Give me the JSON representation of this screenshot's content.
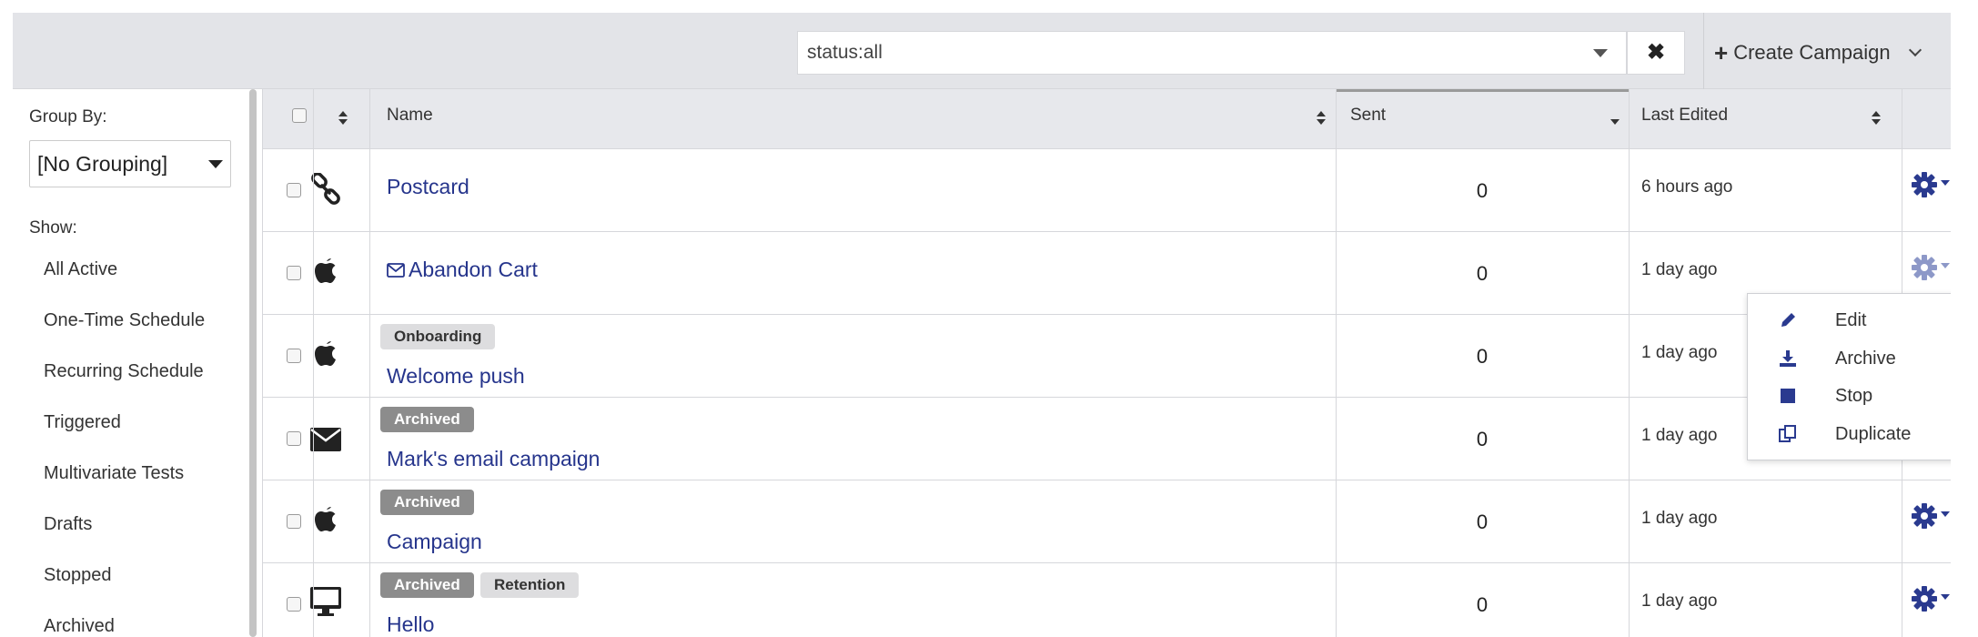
{
  "search": {
    "value": "status:all",
    "clear_icon": "close-icon",
    "caret_icon": "caret-down-icon"
  },
  "create_button": {
    "label": "Create Campaign",
    "icon": "plus-icon"
  },
  "sidebar": {
    "group_by_label": "Group By:",
    "group_by_value": "[No Grouping]",
    "show_label": "Show:",
    "items": [
      {
        "label": "All Active"
      },
      {
        "label": "One-Time Schedule"
      },
      {
        "label": "Recurring Schedule"
      },
      {
        "label": "Triggered"
      },
      {
        "label": "Multivariate Tests"
      },
      {
        "label": "Drafts"
      },
      {
        "label": "Stopped"
      },
      {
        "label": "Archived"
      }
    ]
  },
  "table": {
    "headers": {
      "name": "Name",
      "sent": "Sent",
      "last_edited": "Last Edited"
    },
    "rows": [
      {
        "icon": "link-icon",
        "tags": [],
        "name": "Postcard",
        "sent": "0",
        "edited": "6 hours ago"
      },
      {
        "icon": "apple-icon",
        "tags": [],
        "name": "Abandon Cart",
        "name_icon": "envelope-outline-icon",
        "sent": "0",
        "edited": "1 day ago"
      },
      {
        "icon": "apple-icon",
        "tags": [
          "Onboarding"
        ],
        "name": "Welcome push",
        "sent": "0",
        "edited": "1 day ago"
      },
      {
        "icon": "envelope-icon",
        "tags": [
          "Archived"
        ],
        "name": "Mark's email campaign",
        "sent": "0",
        "edited": "1 day ago"
      },
      {
        "icon": "apple-icon",
        "tags": [
          "Archived"
        ],
        "name": "Campaign",
        "sent": "0",
        "edited": "1 day ago"
      },
      {
        "icon": "desktop-icon",
        "tags": [
          "Archived",
          "Retention"
        ],
        "name": "Hello",
        "sent": "0",
        "edited": "1 day ago"
      }
    ]
  },
  "menu": {
    "items": [
      {
        "label": "Edit",
        "icon": "pencil-icon"
      },
      {
        "label": "Archive",
        "icon": "download-icon"
      },
      {
        "label": "Stop",
        "icon": "stop-icon"
      },
      {
        "label": "Duplicate",
        "icon": "copy-icon"
      }
    ]
  },
  "colors": {
    "link": "#26358c",
    "gear": "#2a3a8f",
    "topbar": "#e3e4e8",
    "tag_archived": "#8c8c8c",
    "tag_light": "#dddddf"
  }
}
